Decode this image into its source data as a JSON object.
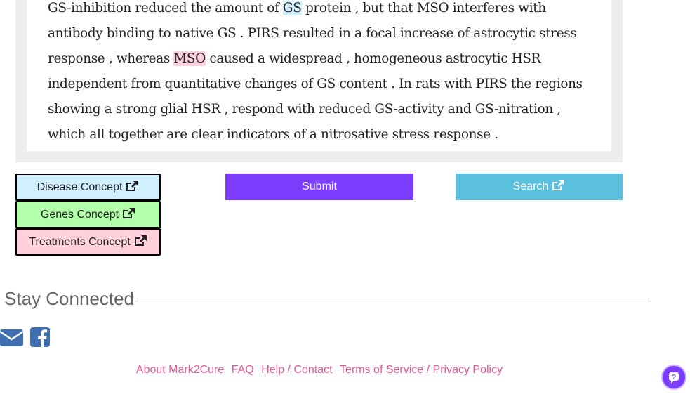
{
  "abstract": {
    "line1": {
      "a": "GS-inhibition reduced the amount of ",
      "gene": "GS",
      "b": " protein , but that MSO interferes with"
    },
    "line2": "antibody binding to native GS . PIRS resulted in a focal increase of astrocytic stress",
    "line3": {
      "a": "response , whereas ",
      "treat": "MSO",
      "b": " caused a widespread , homogeneous astrocytic HSR"
    },
    "line4": "independent from quantitative changes of GS content . In rats with PIRS the regions",
    "line5": "showing a strong glial HSR , respond with reduced GS-activity and GS-nitration ,",
    "line6": "which all together are clear indicators of a nitrosative stress response ."
  },
  "concepts": {
    "disease": "Disease Concept",
    "genes": "Genes Concept",
    "treatments": "Treatments Concept"
  },
  "buttons": {
    "submit": "Submit",
    "search": "Search"
  },
  "stay_connected": "Stay Connected",
  "footer": {
    "links": [
      "About Mark2Cure",
      "FAQ",
      "Help / Contact",
      "Terms of Service / Privacy Policy"
    ]
  },
  "icons": {
    "external": "external-link-icon",
    "email": "envelope-icon",
    "facebook": "facebook-icon",
    "help": "chat-help-icon"
  },
  "colors": {
    "gene_highlight": "#d1f0ff",
    "treatment_highlight": "#ffd1dc",
    "genes_concept": "#b1ffa8",
    "submit": "#7c3dff",
    "search": "#5bc0de",
    "footer_link": "#e05a93",
    "social_icon": "#3f6fb0"
  }
}
